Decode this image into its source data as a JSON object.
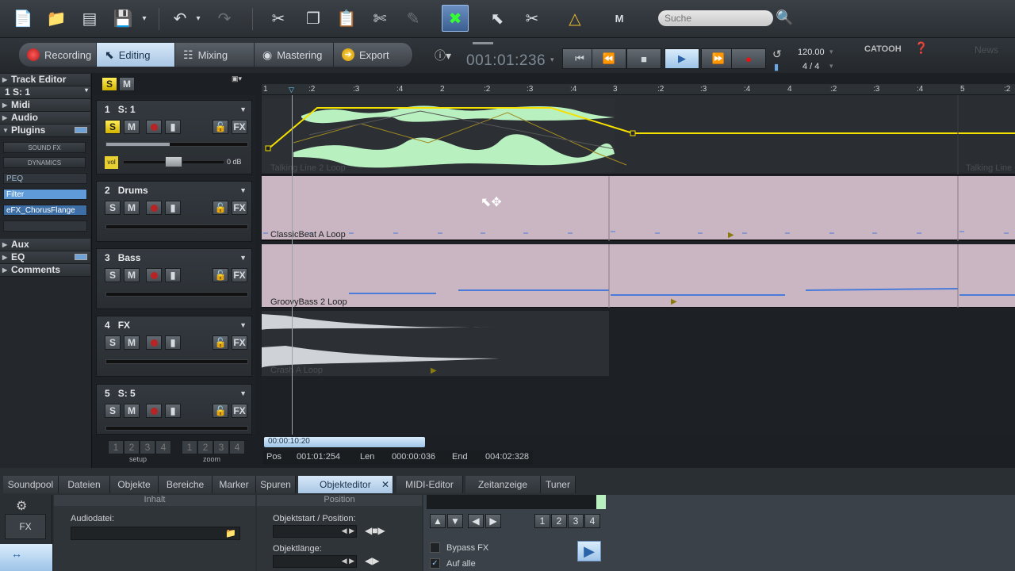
{
  "search": {
    "placeholder": "Suche"
  },
  "modes": [
    {
      "label": "Recording"
    },
    {
      "label": "Editing"
    },
    {
      "label": "Mixing"
    },
    {
      "label": "Mastering"
    },
    {
      "label": "Export"
    }
  ],
  "transport": {
    "timecode": "001:01:236",
    "tempo": "120.00",
    "signature": "4 / 4"
  },
  "brand": {
    "logo": "CATOOH",
    "news": "News"
  },
  "left_panel": {
    "track_editor": "Track Editor",
    "track_select": "1    S: 1",
    "midi": "Midi",
    "audio": "Audio",
    "plugins": "Plugins",
    "sound_fx": "SOUND FX",
    "dynamics": "DYNAMICS",
    "peq": "PEQ",
    "filter": "Filter",
    "chorus": "eFX_ChorusFlange",
    "aux": "Aux",
    "eq": "EQ",
    "comments": "Comments",
    "setup_label": "setup",
    "zoom_label": "zoom",
    "setup_buttons": [
      "1",
      "2",
      "3",
      "4"
    ],
    "zoom_buttons": [
      "1",
      "2",
      "3",
      "4"
    ]
  },
  "tracks": [
    {
      "num": "1",
      "name": "S: 1",
      "volume_label": "vol",
      "volume_value": "0 dB"
    },
    {
      "num": "2",
      "name": "Drums"
    },
    {
      "num": "3",
      "name": "Bass"
    },
    {
      "num": "4",
      "name": "FX"
    },
    {
      "num": "5",
      "name": "S: 5"
    }
  ],
  "track_buttons": {
    "solo": "S",
    "mute": "M",
    "fx": "FX"
  },
  "solo_mute_header": {
    "solo": "S",
    "mute": "M"
  },
  "ruler": [
    "1",
    ":2",
    ":3",
    ":4",
    "2",
    ":2",
    ":3",
    ":4",
    "3",
    ":2",
    ":3",
    ":4",
    "4",
    ":2",
    ":3",
    ":4",
    "5",
    ":2"
  ],
  "clips": [
    {
      "label": "Talking  Line 2   Loop"
    },
    {
      "label": "ClassicBeat A   Loop"
    },
    {
      "label": "GroovyBass 2   Loop"
    },
    {
      "label": "Crash A   Loop"
    },
    {
      "label": "Talking  Line"
    }
  ],
  "position_bar": {
    "scroll_time": "00:00:10:20",
    "pos_label": "Pos",
    "pos_value": "001:01:254",
    "len_label": "Len",
    "len_value": "000:00:036",
    "end_label": "End",
    "end_value": "004:02:328"
  },
  "dock_tabs": [
    "Soundpool",
    "Dateien",
    "Objekte",
    "Bereiche",
    "Marker",
    "Spuren",
    "Objekteditor",
    "MIDI-Editor",
    "Zeitanzeige",
    "Tuner"
  ],
  "object_editor": {
    "inhalt": "Inhalt",
    "position": "Position",
    "audiodatei": "Audiodatei:",
    "objektstart": "Objektstart / Position:",
    "objektlaenge": "Objektlänge:",
    "fx": "FX",
    "bypass_fx": "Bypass FX",
    "auf_alle": "Auf alle",
    "num_buttons": [
      "1",
      "2",
      "3",
      "4"
    ]
  }
}
